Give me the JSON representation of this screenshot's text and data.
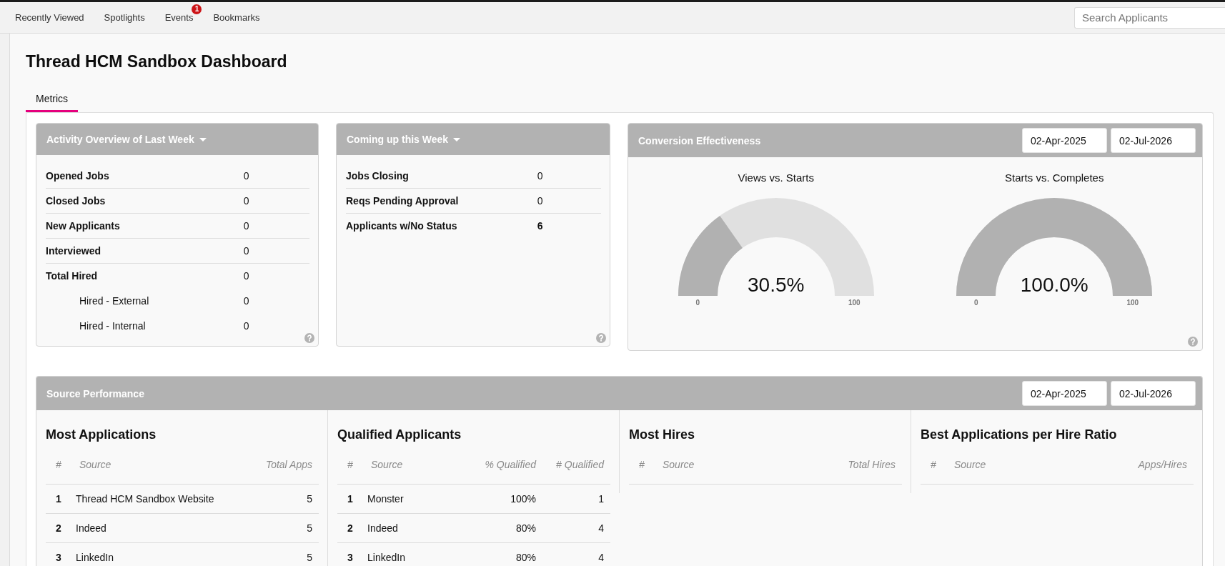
{
  "top_nav": {
    "items": [
      {
        "label": "Recently Viewed"
      },
      {
        "label": "Spotlights"
      },
      {
        "label": "Events",
        "badge": "1"
      },
      {
        "label": "Bookmarks"
      }
    ],
    "search": {
      "placeholder": "Search Applicants"
    }
  },
  "page": {
    "title": "Thread HCM Sandbox Dashboard"
  },
  "tabs": [
    {
      "label": "Metrics",
      "selected": true
    }
  ],
  "activity_overview": {
    "title": "Activity Overview of Last Week",
    "rows": [
      {
        "label": "Opened Jobs",
        "value": "0",
        "kind": "main",
        "emphasized": false
      },
      {
        "label": "Closed Jobs",
        "value": "0",
        "kind": "main",
        "emphasized": false
      },
      {
        "label": "New Applicants",
        "value": "0",
        "kind": "main",
        "emphasized": false
      },
      {
        "label": "Interviewed",
        "value": "0",
        "kind": "main",
        "emphasized": false
      },
      {
        "label": "Total Hired",
        "value": "0",
        "kind": "main",
        "emphasized": false
      },
      {
        "label": "Hired - External",
        "value": "0",
        "kind": "sub",
        "emphasized": false
      },
      {
        "label": "Hired - Internal",
        "value": "0",
        "kind": "sub",
        "emphasized": false
      }
    ]
  },
  "coming_up": {
    "title": "Coming up this Week",
    "rows": [
      {
        "label": "Jobs Closing",
        "value": "0",
        "kind": "main",
        "emphasized": false
      },
      {
        "label": "Reqs Pending Approval",
        "value": "0",
        "kind": "main",
        "emphasized": false
      },
      {
        "label": "Applicants w/No Status",
        "value": "6",
        "kind": "main",
        "emphasized": true
      }
    ]
  },
  "conversion": {
    "title": "Conversion Effectiveness",
    "date_from": "02-Apr-2025",
    "date_to": "02-Jul-2026",
    "gauges": [
      {
        "title": "Views vs. Starts",
        "level": 0.305,
        "value": "30.5%",
        "min_label": "0",
        "max_label": "100"
      },
      {
        "title": "Starts vs. Completes",
        "level": 1,
        "value": "100.0%",
        "min_label": "0",
        "max_label": "100"
      }
    ]
  },
  "source_performance": {
    "title": "Source Performance",
    "date_from": "02-Apr-2025",
    "date_to": "02-Jul-2026",
    "tables": [
      {
        "title": "Most Applications",
        "columns": [
          "#",
          "Source",
          "Total Apps"
        ],
        "rows": [
          [
            "1",
            "Thread HCM Sandbox Website",
            "5"
          ],
          [
            "2",
            "Indeed",
            "5"
          ],
          [
            "3",
            "LinkedIn",
            "5"
          ]
        ]
      },
      {
        "title": "Qualified Applicants",
        "columns": [
          "#",
          "Source",
          "% Qualified",
          "# Qualified"
        ],
        "rows": [
          [
            "1",
            "Monster",
            "100%",
            "1"
          ],
          [
            "2",
            "Indeed",
            "80%",
            "4"
          ],
          [
            "3",
            "LinkedIn",
            "80%",
            "4"
          ]
        ]
      },
      {
        "title": "Most Hires",
        "columns": [
          "#",
          "Source",
          "Total Hires"
        ]
      },
      {
        "title": "Best Applications per Hire Ratio",
        "columns": [
          "#",
          "Source",
          "Apps/Hires"
        ]
      }
    ]
  }
}
